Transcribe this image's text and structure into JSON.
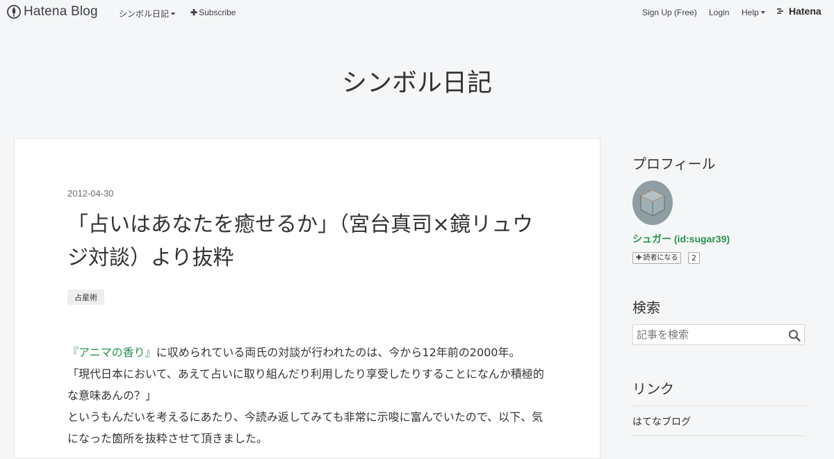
{
  "topbar": {
    "brand": "Hatena Blog",
    "blog_menu": "シンボル日記",
    "subscribe": "Subscribe",
    "signup": "Sign Up (Free)",
    "login": "Login",
    "help": "Help",
    "hatena": "Hatena"
  },
  "blog": {
    "title": "シンボル日記"
  },
  "entry": {
    "date": "2012-04-30",
    "title": "「占いはあなたを癒せるか」（宮台真司×鏡リュウジ対談）より抜粋",
    "category": "占星術",
    "book_link": "『アニマの香り』",
    "line1_rest": "に収められている両氏の対談が行われたのは、今から12年前の2000年。",
    "line2": "「現代日本において、あえて占いに取り組んだり利用したり享受したりすることになんか積極的な意味あんの？」",
    "line3": "というもんだいを考えるにあたり、今読み返してみても非常に示唆に富んでいたので、以下、気になった箇所を抜粋させて頂きました。"
  },
  "sidebar": {
    "profile_heading": "プロフィール",
    "username": "シュガー (id:sugar39)",
    "subscribe_button": "読者になる",
    "subscriber_count": "2",
    "search_heading": "検索",
    "search_placeholder": "記事を検索",
    "links_heading": "リンク",
    "link_hatena_blog": "はてなブログ"
  },
  "colors": {
    "accent_green": "#27914d",
    "background": "#f5f6f7"
  },
  "icons": [
    "hatena-blog-logo-icon",
    "caret-down-icon",
    "plus-icon",
    "hatena-logo-icon",
    "avatar-cube-icon",
    "search-icon"
  ]
}
